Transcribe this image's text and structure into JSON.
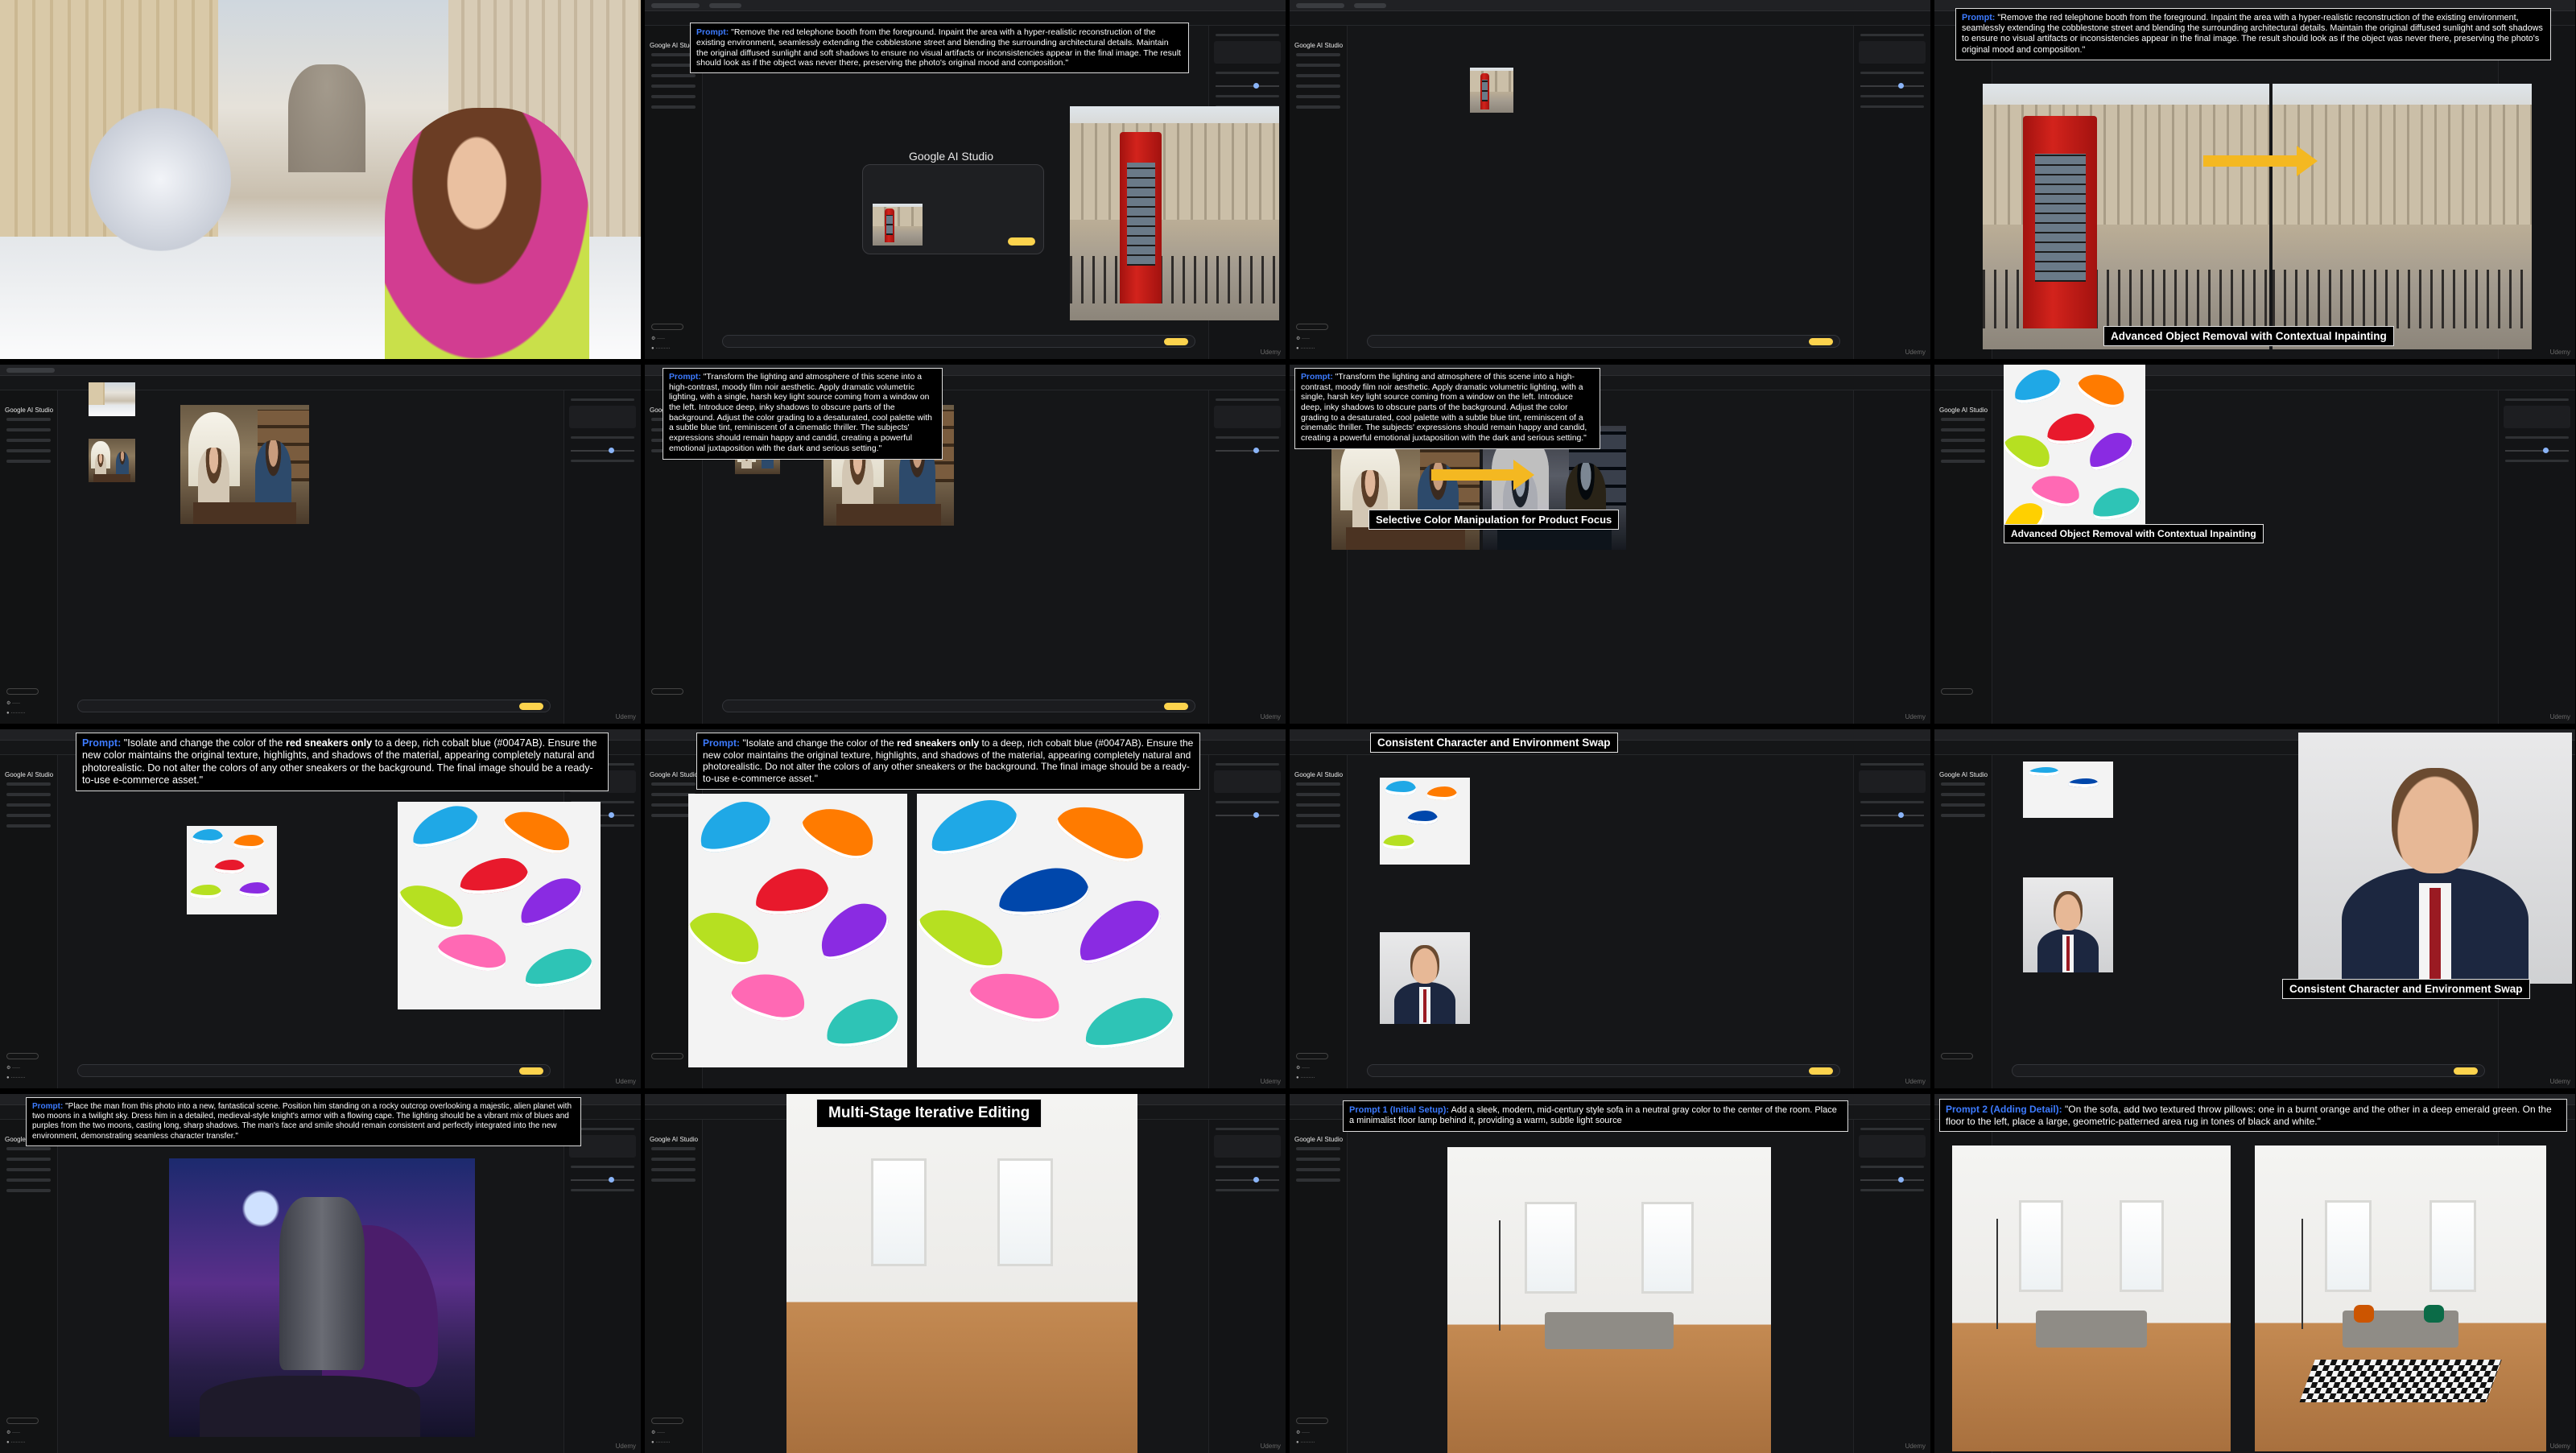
{
  "app": {
    "studio_name": "Google AI Studio",
    "watermark": "Udemy"
  },
  "labels": {
    "prompt": "Prompt:",
    "initial_setup": "Prompt 1 (Initial Setup):",
    "adding_detail": "Prompt 2 (Adding Detail):"
  },
  "captions": {
    "object_removal": "Advanced Object Removal with Contextual Inpainting",
    "color_manipulation": "Selective Color Manipulation for Product Focus",
    "character_swap": "Consistent Character and Environment Swap",
    "iterative_editing": "Multi-Stage Iterative Editing"
  },
  "prompts": {
    "booth": "\"Remove the red telephone booth from the foreground. Inpaint the area with a hyper-realistic reconstruction of the existing environment, seamlessly extending the cobblestone street and blending the surrounding architectural details. Maintain the original diffused sunlight and soft shadows to ensure no visual artifacts or inconsistencies appear in the final image. The result should look as if the object was never there, preserving the photo's original mood and composition.\"",
    "noir": "\"Transform the lighting and atmosphere of this scene into a high-contrast, moody film noir aesthetic. Apply dramatic volumetric lighting, with a single, harsh key light source coming from a window on the left. Introduce deep, inky shadows to obscure parts of the background. Adjust the color grading to a desaturated, cool palette with a subtle blue tint, reminiscent of a cinematic thriller. The subjects' expressions should remain happy and candid, creating a powerful emotional juxtaposition with the dark and serious setting.\"",
    "sneakers_pre": "\"Isolate and change the color of the ",
    "sneakers_hl": "red sneakers only",
    "sneakers_post": " to a deep, rich cobalt blue (#0047AB). Ensure the new color maintains the original texture, highlights, and shadows of the material, appearing completely natural and photorealistic. Do not alter the colors of any other sneakers or the background. The final image should be a ready-to-use e-commerce asset.\"",
    "knight": "\"Place the man from this photo into a new, fantastical scene. Position him standing on a rocky outcrop overlooking a majestic, alien planet with two moons in a twilight sky. Dress him in a detailed, medieval-style knight's armor with a flowing cape. The lighting should be a vibrant mix of blues and purples from the two moons, casting long, sharp shadows. The man's face and smile should remain consistent and perfectly integrated into the new environment, demonstrating seamless character transfer.\"",
    "sofa": "Add a sleek, modern, mid-century style sofa in a neutral gray color to the center of the room. Place a minimalist floor lamp behind it, providing a warm, subtle light source",
    "pillows": "\"On the sofa, add two textured throw pillows: one in a burnt orange and the other in a deep emerald green. On the floor to the left, place a large, geometric-patterned area rug in tones of black and white.\""
  },
  "colors": {
    "prompt_label": "#3d7bff",
    "arrow": "#f4b821",
    "run_button": "#fcd34d",
    "booth_red": "#d3231c",
    "cobalt": "#0047AB"
  }
}
